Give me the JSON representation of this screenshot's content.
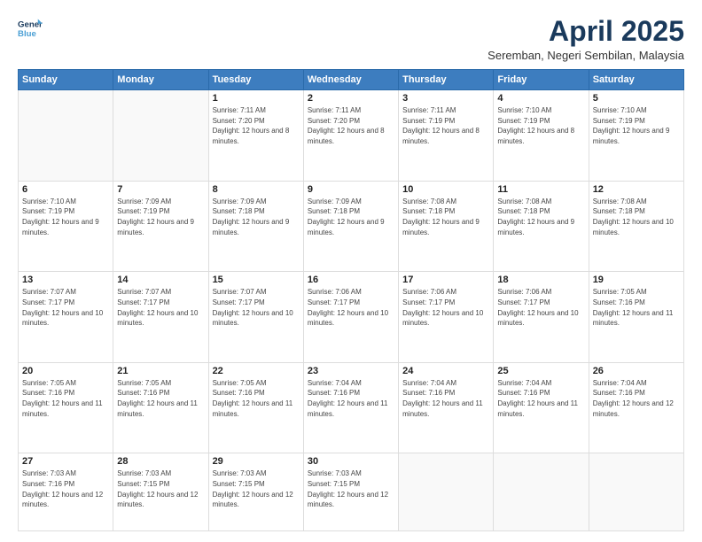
{
  "logo": {
    "line1": "General",
    "line2": "Blue"
  },
  "header": {
    "month_year": "April 2025",
    "location": "Seremban, Negeri Sembilan, Malaysia"
  },
  "days_of_week": [
    "Sunday",
    "Monday",
    "Tuesday",
    "Wednesday",
    "Thursday",
    "Friday",
    "Saturday"
  ],
  "weeks": [
    [
      {
        "day": "",
        "empty": true
      },
      {
        "day": "",
        "empty": true
      },
      {
        "day": "1",
        "sunrise": "7:11 AM",
        "sunset": "7:20 PM",
        "daylight": "12 hours and 8 minutes."
      },
      {
        "day": "2",
        "sunrise": "7:11 AM",
        "sunset": "7:20 PM",
        "daylight": "12 hours and 8 minutes."
      },
      {
        "day": "3",
        "sunrise": "7:11 AM",
        "sunset": "7:19 PM",
        "daylight": "12 hours and 8 minutes."
      },
      {
        "day": "4",
        "sunrise": "7:10 AM",
        "sunset": "7:19 PM",
        "daylight": "12 hours and 8 minutes."
      },
      {
        "day": "5",
        "sunrise": "7:10 AM",
        "sunset": "7:19 PM",
        "daylight": "12 hours and 9 minutes."
      }
    ],
    [
      {
        "day": "6",
        "sunrise": "7:10 AM",
        "sunset": "7:19 PM",
        "daylight": "12 hours and 9 minutes."
      },
      {
        "day": "7",
        "sunrise": "7:09 AM",
        "sunset": "7:19 PM",
        "daylight": "12 hours and 9 minutes."
      },
      {
        "day": "8",
        "sunrise": "7:09 AM",
        "sunset": "7:18 PM",
        "daylight": "12 hours and 9 minutes."
      },
      {
        "day": "9",
        "sunrise": "7:09 AM",
        "sunset": "7:18 PM",
        "daylight": "12 hours and 9 minutes."
      },
      {
        "day": "10",
        "sunrise": "7:08 AM",
        "sunset": "7:18 PM",
        "daylight": "12 hours and 9 minutes."
      },
      {
        "day": "11",
        "sunrise": "7:08 AM",
        "sunset": "7:18 PM",
        "daylight": "12 hours and 9 minutes."
      },
      {
        "day": "12",
        "sunrise": "7:08 AM",
        "sunset": "7:18 PM",
        "daylight": "12 hours and 10 minutes."
      }
    ],
    [
      {
        "day": "13",
        "sunrise": "7:07 AM",
        "sunset": "7:17 PM",
        "daylight": "12 hours and 10 minutes."
      },
      {
        "day": "14",
        "sunrise": "7:07 AM",
        "sunset": "7:17 PM",
        "daylight": "12 hours and 10 minutes."
      },
      {
        "day": "15",
        "sunrise": "7:07 AM",
        "sunset": "7:17 PM",
        "daylight": "12 hours and 10 minutes."
      },
      {
        "day": "16",
        "sunrise": "7:06 AM",
        "sunset": "7:17 PM",
        "daylight": "12 hours and 10 minutes."
      },
      {
        "day": "17",
        "sunrise": "7:06 AM",
        "sunset": "7:17 PM",
        "daylight": "12 hours and 10 minutes."
      },
      {
        "day": "18",
        "sunrise": "7:06 AM",
        "sunset": "7:17 PM",
        "daylight": "12 hours and 10 minutes."
      },
      {
        "day": "19",
        "sunrise": "7:05 AM",
        "sunset": "7:16 PM",
        "daylight": "12 hours and 11 minutes."
      }
    ],
    [
      {
        "day": "20",
        "sunrise": "7:05 AM",
        "sunset": "7:16 PM",
        "daylight": "12 hours and 11 minutes."
      },
      {
        "day": "21",
        "sunrise": "7:05 AM",
        "sunset": "7:16 PM",
        "daylight": "12 hours and 11 minutes."
      },
      {
        "day": "22",
        "sunrise": "7:05 AM",
        "sunset": "7:16 PM",
        "daylight": "12 hours and 11 minutes."
      },
      {
        "day": "23",
        "sunrise": "7:04 AM",
        "sunset": "7:16 PM",
        "daylight": "12 hours and 11 minutes."
      },
      {
        "day": "24",
        "sunrise": "7:04 AM",
        "sunset": "7:16 PM",
        "daylight": "12 hours and 11 minutes."
      },
      {
        "day": "25",
        "sunrise": "7:04 AM",
        "sunset": "7:16 PM",
        "daylight": "12 hours and 11 minutes."
      },
      {
        "day": "26",
        "sunrise": "7:04 AM",
        "sunset": "7:16 PM",
        "daylight": "12 hours and 12 minutes."
      }
    ],
    [
      {
        "day": "27",
        "sunrise": "7:03 AM",
        "sunset": "7:16 PM",
        "daylight": "12 hours and 12 minutes."
      },
      {
        "day": "28",
        "sunrise": "7:03 AM",
        "sunset": "7:15 PM",
        "daylight": "12 hours and 12 minutes."
      },
      {
        "day": "29",
        "sunrise": "7:03 AM",
        "sunset": "7:15 PM",
        "daylight": "12 hours and 12 minutes."
      },
      {
        "day": "30",
        "sunrise": "7:03 AM",
        "sunset": "7:15 PM",
        "daylight": "12 hours and 12 minutes."
      },
      {
        "day": "",
        "empty": true
      },
      {
        "day": "",
        "empty": true
      },
      {
        "day": "",
        "empty": true
      }
    ]
  ]
}
